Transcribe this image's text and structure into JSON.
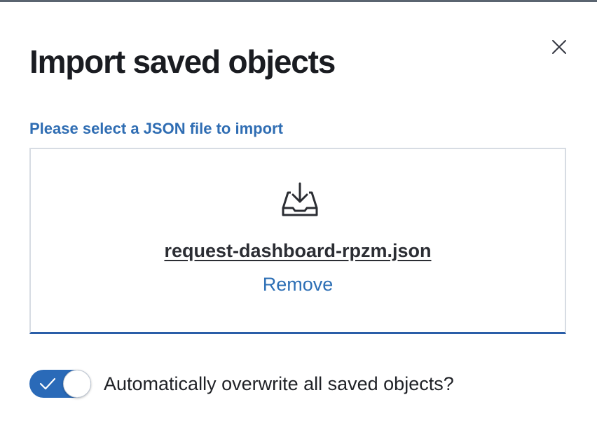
{
  "flyout": {
    "title": "Import saved objects",
    "close_icon": "close-icon"
  },
  "file_picker": {
    "label": "Please select a JSON file to import",
    "icon": "import-tray-icon",
    "file_name": "request-dashboard-rpzm.json",
    "remove_label": "Remove"
  },
  "overwrite": {
    "label": "Automatically overwrite all saved objects?",
    "checked": true,
    "icon": "checkmark-icon"
  },
  "colors": {
    "accent": "#2a6ab8",
    "link": "#2d6fb5",
    "title_text": "#1a1c21"
  }
}
